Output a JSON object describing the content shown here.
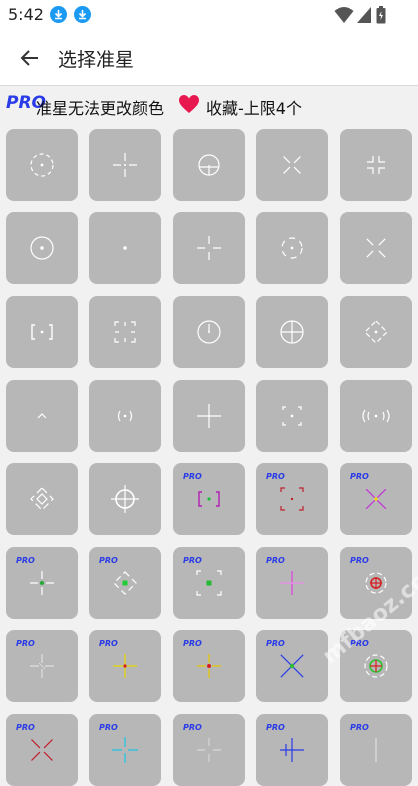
{
  "status_bar": {
    "time": "5:42"
  },
  "header": {
    "title": "选择准星"
  },
  "info": {
    "pro_label": "PRO",
    "pro_note": "准星无法更改颜色",
    "favorite_note": "收藏-上限4个"
  },
  "watermark": "mfbaoz.com",
  "colors": {
    "pro_blue": "#2a3be8",
    "heart_red": "#e8194f",
    "tile_gray": "#b7b7b7",
    "download_blue": "#1a9af2"
  },
  "crosshairs": [
    {
      "icon": "dashed-circle-dot",
      "pro": false
    },
    {
      "icon": "gap-cross-dot",
      "pro": false
    },
    {
      "icon": "circle-cross",
      "pro": false
    },
    {
      "icon": "x-cross",
      "pro": false
    },
    {
      "icon": "corner-cross",
      "pro": false
    },
    {
      "icon": "circle-dot",
      "pro": false
    },
    {
      "icon": "dot",
      "pro": false
    },
    {
      "icon": "thin-cross",
      "pro": false
    },
    {
      "icon": "bracket-circle-dot",
      "pro": false
    },
    {
      "icon": "gap-x",
      "pro": false
    },
    {
      "icon": "bracket-dot",
      "pro": false
    },
    {
      "icon": "corner-bracket-dot",
      "pro": false
    },
    {
      "icon": "circle-tick",
      "pro": false
    },
    {
      "icon": "circle-cross-full",
      "pro": false
    },
    {
      "icon": "diamond-dot",
      "pro": false
    },
    {
      "icon": "chevron",
      "pro": false
    },
    {
      "icon": "paren-dot",
      "pro": false
    },
    {
      "icon": "plain-cross",
      "pro": false
    },
    {
      "icon": "small-corners-dot",
      "pro": false
    },
    {
      "icon": "double-paren",
      "pro": false
    },
    {
      "icon": "broken-diamond",
      "pro": false
    },
    {
      "icon": "circle-scope",
      "pro": false
    },
    {
      "icon": "color-brackets",
      "pro": true,
      "label": "PRO",
      "color": "#b21fb2"
    },
    {
      "icon": "color-corners",
      "pro": true,
      "label": "PRO",
      "color": "#c0202b"
    },
    {
      "icon": "color-x",
      "pro": true,
      "label": "PRO",
      "color": "#c230d6"
    },
    {
      "icon": "color-cross-dot",
      "pro": true,
      "label": "PRO",
      "color": "#22aa33"
    },
    {
      "icon": "color-diamond-dot",
      "pro": true,
      "label": "PRO",
      "color": "#22cc33"
    },
    {
      "icon": "color-corner-dot",
      "pro": true,
      "label": "PRO",
      "color": "#22bb33"
    },
    {
      "icon": "color-pink-cross",
      "pro": true,
      "label": "PRO",
      "color": "#e040e0"
    },
    {
      "icon": "color-circle-cross",
      "pro": true,
      "label": "PRO",
      "color": "#d62020"
    },
    {
      "icon": "color-gap-cross",
      "pro": true,
      "label": "PRO",
      "color": "#e0e0e0"
    },
    {
      "icon": "color-yellow-cross",
      "pro": true,
      "label": "PRO",
      "color": "#e6d800"
    },
    {
      "icon": "color-red-yellow-cross",
      "pro": true,
      "label": "PRO",
      "color": "#e6c800"
    },
    {
      "icon": "color-green-x",
      "pro": true,
      "label": "PRO",
      "color": "#2ec02e"
    },
    {
      "icon": "color-green-scope",
      "pro": true,
      "label": "PRO",
      "color": "#30c030"
    },
    {
      "icon": "color-red-x",
      "pro": true,
      "label": "PRO",
      "color": "#c21b2b"
    },
    {
      "icon": "color-cyan-cross",
      "pro": true,
      "label": "PRO",
      "color": "#1ec7e6"
    },
    {
      "icon": "color-partial",
      "pro": true,
      "label": "PRO",
      "color": "#d8d8d8"
    },
    {
      "icon": "color-blue-cross",
      "pro": true,
      "label": "PRO",
      "color": "#2a3be8"
    },
    {
      "icon": "color-partial-2",
      "pro": true,
      "label": "PRO",
      "color": "#e0e0e0"
    }
  ]
}
